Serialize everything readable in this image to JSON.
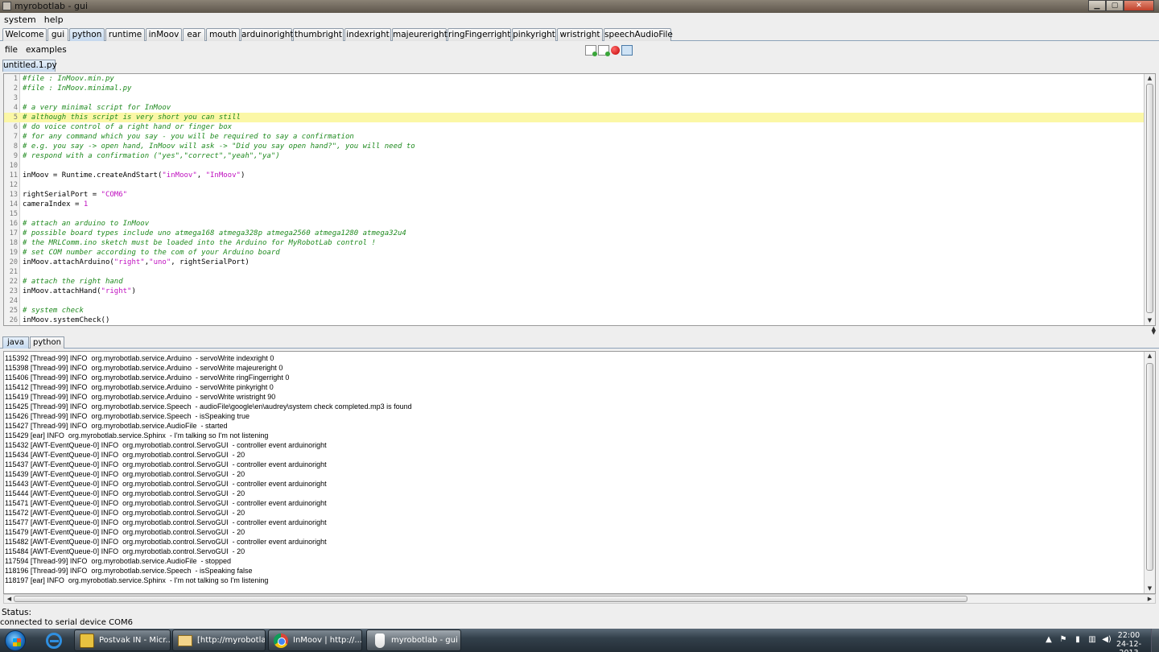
{
  "window": {
    "title": "myrobotlab - gui",
    "min_glyph": "▁",
    "max_glyph": "▢",
    "close_glyph": "✕"
  },
  "menubar": {
    "items": [
      "system",
      "help"
    ]
  },
  "tabs": [
    "Welcome",
    "gui",
    "python",
    "runtime",
    "inMoov",
    "ear",
    "mouth",
    "arduinoright",
    "thumbright",
    "indexright",
    "majeureright",
    "ringFingerright",
    "pinkyright",
    "wristright",
    "speechAudioFile"
  ],
  "active_tab": "python",
  "python": {
    "menu": [
      "file",
      "examples"
    ],
    "file_tab": "untitled.1.py",
    "code_lines": [
      "#file : InMoov.min.py",
      "#file : InMoov.minimal.py",
      "",
      "# a very minimal script for InMoov",
      "# although this script is very short you can still",
      "# do voice control of a right hand or finger box",
      "# for any command which you say - you will be required to say a confirmation",
      "# e.g. you say -> open hand, InMoov will ask -> \"Did you say open hand?\", you will need to",
      "# respond with a confirmation (\"yes\",\"correct\",\"yeah\",\"ya\")",
      "",
      "inMoov = Runtime.createAndStart(\"inMoov\", \"InMoov\")",
      "",
      "rightSerialPort = \"COM6\"",
      "cameraIndex = 1",
      "",
      "# attach an arduino to InMoov",
      "# possible board types include uno atmega168 atmega328p atmega2560 atmega1280 atmega32u4",
      "# the MRLComm.ino sketch must be loaded into the Arduino for MyRobotLab control !",
      "# set COM number according to the com of your Arduino board",
      "inMoov.attachArduino(\"right\",\"uno\", rightSerialPort)",
      "",
      "# attach the right hand",
      "inMoov.attachHand(\"right\")",
      "",
      "# system check",
      "inMoov.systemCheck()"
    ],
    "highlight_line": 5
  },
  "bottom_tabs": [
    "java",
    "python"
  ],
  "log_lines": [
    "115392 [Thread-99] INFO  org.myrobotlab.service.Arduino  - servoWrite indexright 0",
    "115398 [Thread-99] INFO  org.myrobotlab.service.Arduino  - servoWrite majeureright 0",
    "115406 [Thread-99] INFO  org.myrobotlab.service.Arduino  - servoWrite ringFingerright 0",
    "115412 [Thread-99] INFO  org.myrobotlab.service.Arduino  - servoWrite pinkyright 0",
    "115419 [Thread-99] INFO  org.myrobotlab.service.Arduino  - servoWrite wristright 90",
    "115425 [Thread-99] INFO  org.myrobotlab.service.Speech  - audioFile\\google\\en\\audrey\\system check completed.mp3 is found",
    "115426 [Thread-99] INFO  org.myrobotlab.service.Speech  - isSpeaking true",
    "115427 [Thread-99] INFO  org.myrobotlab.service.AudioFile  - started",
    "115429 [ear] INFO  org.myrobotlab.service.Sphinx  - I'm talking so I'm not listening",
    "115432 [AWT-EventQueue-0] INFO  org.myrobotlab.control.ServoGUI  - controller event arduinoright",
    "115434 [AWT-EventQueue-0] INFO  org.myrobotlab.control.ServoGUI  - 20",
    "115437 [AWT-EventQueue-0] INFO  org.myrobotlab.control.ServoGUI  - controller event arduinoright",
    "115439 [AWT-EventQueue-0] INFO  org.myrobotlab.control.ServoGUI  - 20",
    "115443 [AWT-EventQueue-0] INFO  org.myrobotlab.control.ServoGUI  - controller event arduinoright",
    "115444 [AWT-EventQueue-0] INFO  org.myrobotlab.control.ServoGUI  - 20",
    "115471 [AWT-EventQueue-0] INFO  org.myrobotlab.control.ServoGUI  - controller event arduinoright",
    "115472 [AWT-EventQueue-0] INFO  org.myrobotlab.control.ServoGUI  - 20",
    "115477 [AWT-EventQueue-0] INFO  org.myrobotlab.control.ServoGUI  - controller event arduinoright",
    "115479 [AWT-EventQueue-0] INFO  org.myrobotlab.control.ServoGUI  - 20",
    "115482 [AWT-EventQueue-0] INFO  org.myrobotlab.control.ServoGUI  - controller event arduinoright",
    "115484 [AWT-EventQueue-0] INFO  org.myrobotlab.control.ServoGUI  - 20",
    "117594 [Thread-99] INFO  org.myrobotlab.service.AudioFile  - stopped",
    "118196 [Thread-99] INFO  org.myrobotlab.service.Speech  - isSpeaking false",
    "118197 [ear] INFO  org.myrobotlab.service.Sphinx  - I'm not talking so I'm listening"
  ],
  "status": {
    "label": "Status:",
    "text": "connected to serial device COM6"
  },
  "taskbar": {
    "items": [
      {
        "label": "Postvak IN - Micr...",
        "icon": "outlook-icon"
      },
      {
        "label": "[http://myrobotla...",
        "icon": "mail-icon"
      },
      {
        "label": "InMoov | http://...",
        "icon": "chrome-icon"
      },
      {
        "label": "myrobotlab - gui",
        "icon": "java-icon"
      }
    ],
    "tray_icons": [
      "▲",
      "⚑",
      "▮",
      "▥",
      "◀)"
    ],
    "time": "22:00",
    "date": "24-12-2013"
  },
  "colors": {
    "comment": "#1f8a1f",
    "string": "#c011c0",
    "highlight": "#fbf7a6",
    "active_tab": "#c4d8ee"
  }
}
